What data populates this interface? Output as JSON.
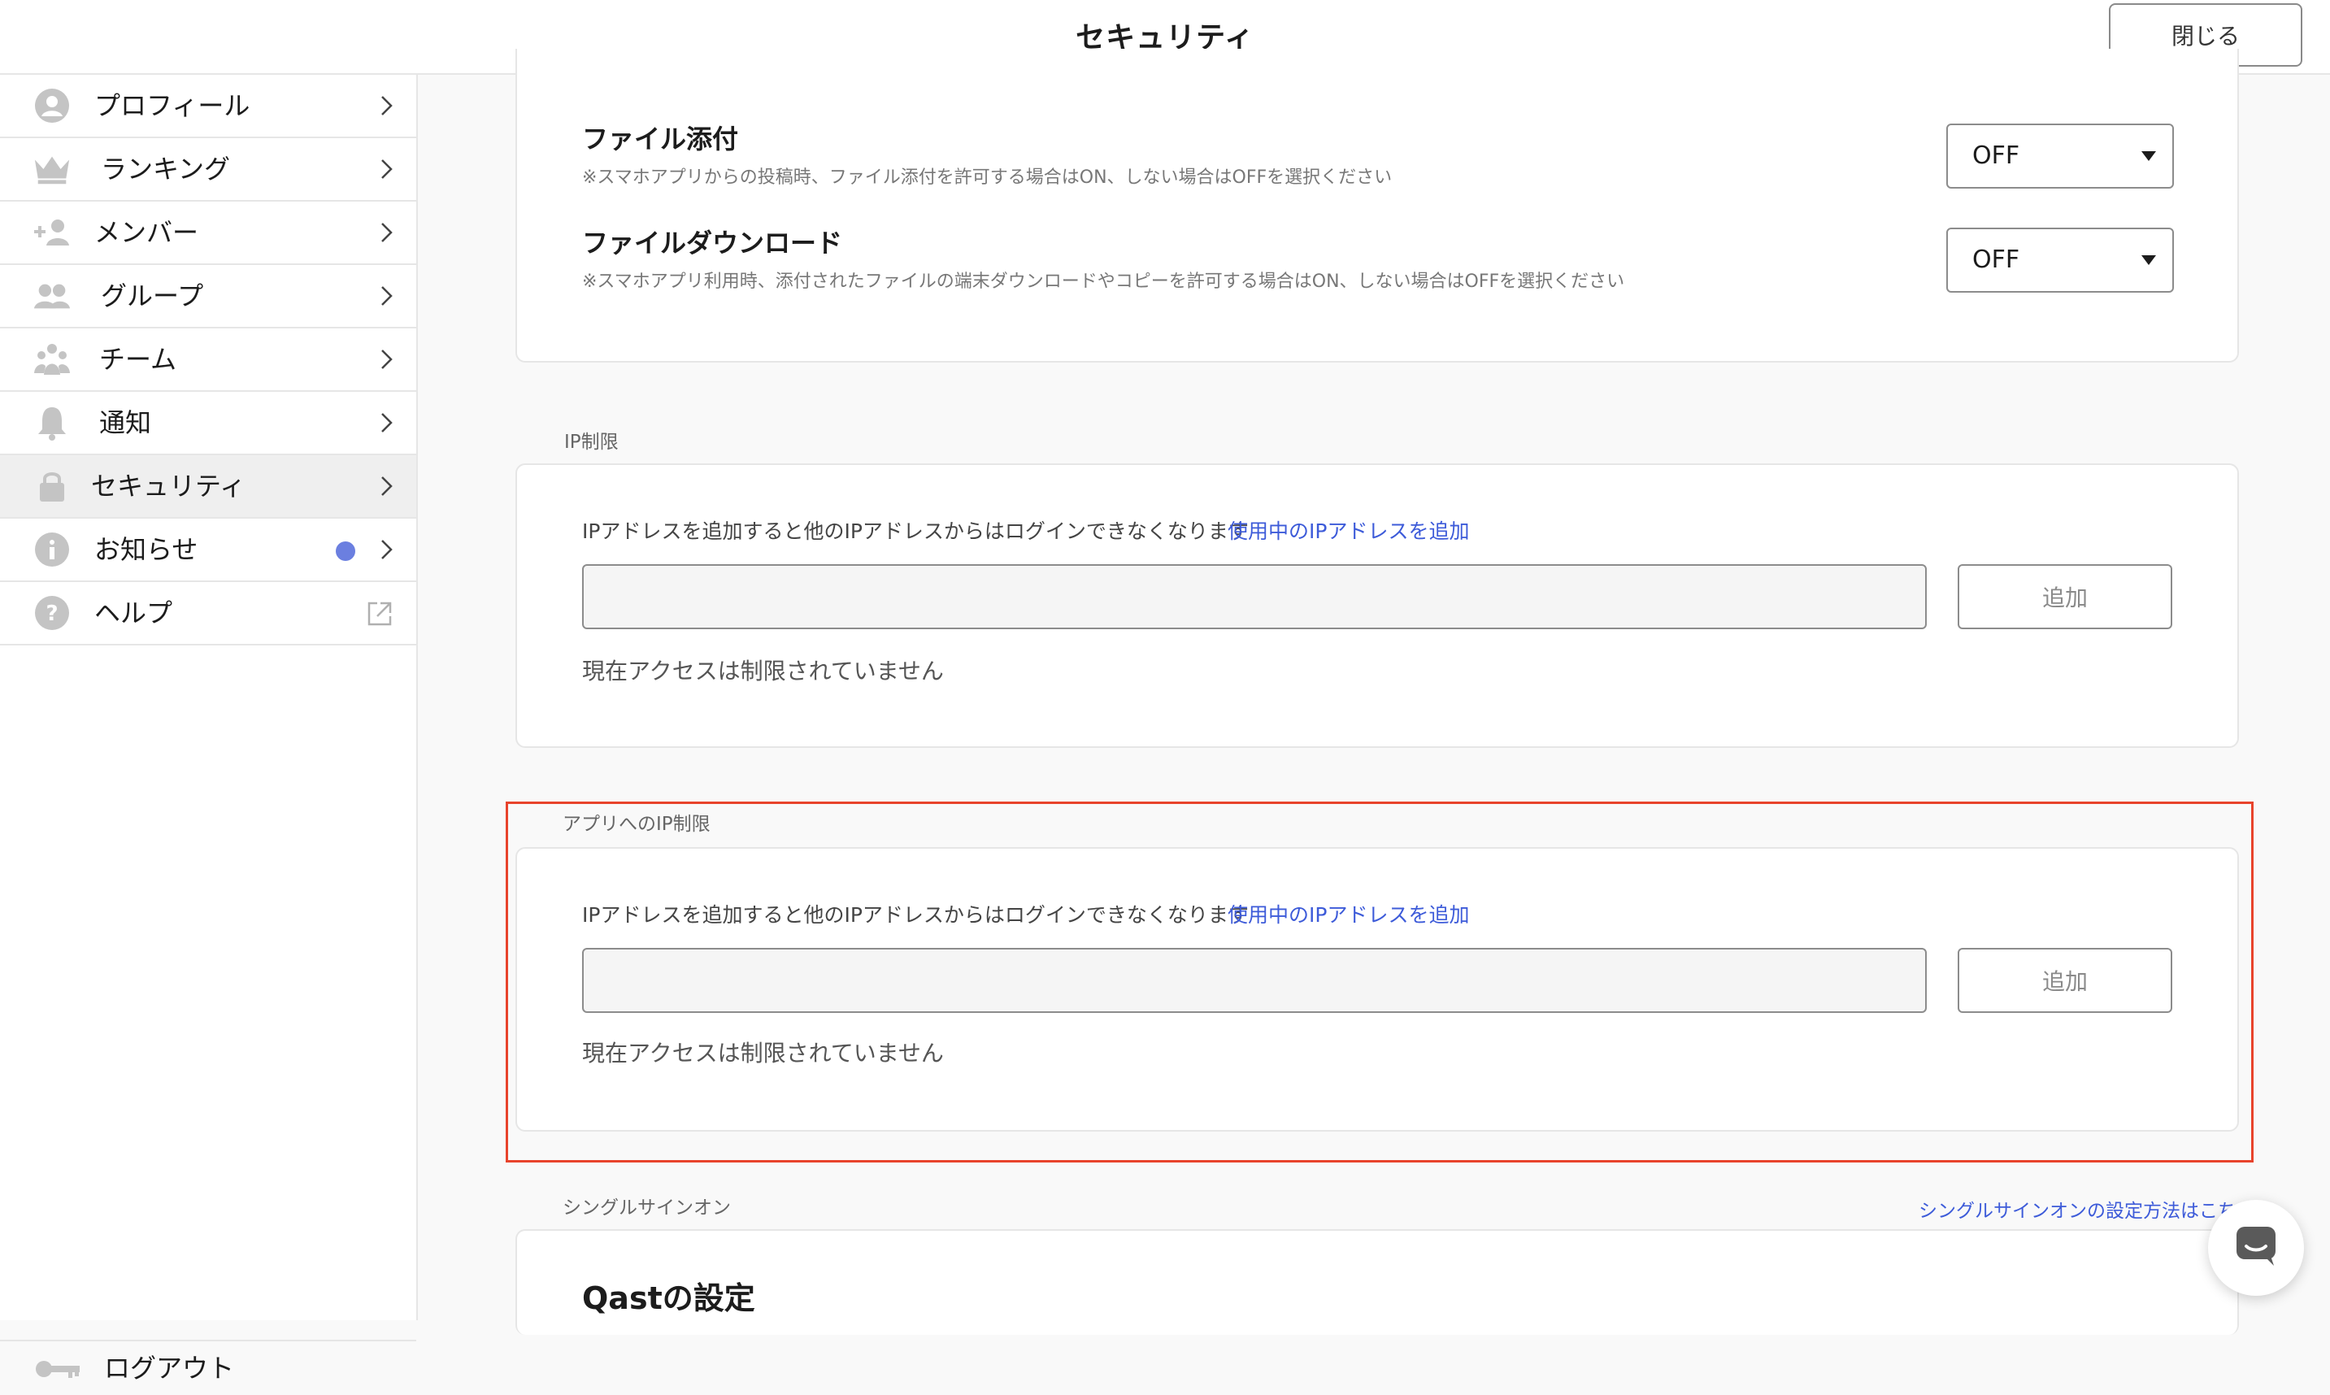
{
  "header": {
    "title": "セキュリティ",
    "close_label": "閉じる"
  },
  "sidebar": {
    "items": [
      {
        "label": "プロフィール",
        "icon": "profile-icon"
      },
      {
        "label": "ランキング",
        "icon": "crown-icon"
      },
      {
        "label": "メンバー",
        "icon": "add-member-icon"
      },
      {
        "label": "グループ",
        "icon": "group-icon"
      },
      {
        "label": "チーム",
        "icon": "team-icon"
      },
      {
        "label": "通知",
        "icon": "bell-icon"
      },
      {
        "label": "セキュリティ",
        "icon": "lock-icon",
        "active": true
      },
      {
        "label": "お知らせ",
        "icon": "info-icon",
        "unread_dot": true
      },
      {
        "label": "ヘルプ",
        "icon": "help-icon",
        "external": true
      }
    ],
    "logout_label": "ログアウト"
  },
  "file_settings": {
    "attachment": {
      "title": "ファイル添付",
      "note": "※スマホアプリからの投稿時、ファイル添付を許可する場合はON、しない場合はOFFを選択ください",
      "value": "OFF"
    },
    "download": {
      "title": "ファイルダウンロード",
      "note": "※スマホアプリ利用時、添付されたファイルの端末ダウンロードやコピーを許可する場合はON、しない場合はOFFを選択ください",
      "value": "OFF"
    }
  },
  "ip_restriction": {
    "section_label": "IP制限",
    "description": "IPアドレスを追加すると他のIPアドレスからはログインできなくなります",
    "link": "使用中のIPアドレスを追加",
    "input_value": "",
    "add_label": "追加",
    "status": "現在アクセスは制限されていません"
  },
  "app_ip_restriction": {
    "section_label": "アプリへのIP制限",
    "description": "IPアドレスを追加すると他のIPアドレスからはログインできなくなります",
    "link": "使用中のIPアドレスを追加",
    "input_value": "",
    "add_label": "追加",
    "status": "現在アクセスは制限されていません"
  },
  "sso": {
    "section_label": "シングルサインオン",
    "help_link": "シングルサインオンの設定方法はこちら",
    "card_title": "Qastの設定"
  },
  "colors": {
    "accent": "#3d5bd9",
    "highlight": "#e8432c",
    "unread_dot": "#6b7fe0"
  }
}
